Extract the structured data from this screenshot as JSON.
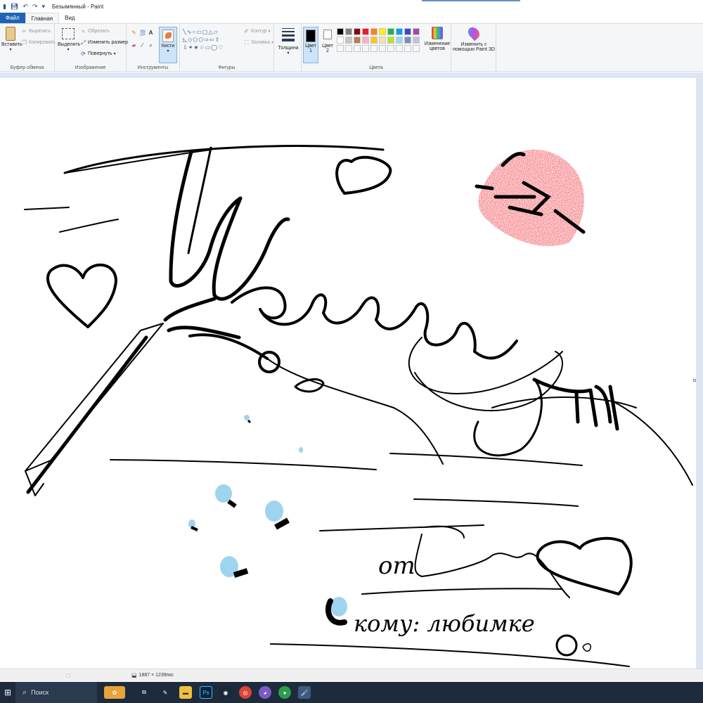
{
  "window": {
    "title": "Безымянный - Paint"
  },
  "tabs": [
    {
      "label": "Файл"
    },
    {
      "label": "Главная"
    },
    {
      "label": "Вид"
    }
  ],
  "ribbon": {
    "clipboard": {
      "paste_label": "Вставить",
      "cut_label": "Вырезать",
      "copy_label": "Копировать",
      "group_label": "Буфер обмена"
    },
    "image": {
      "select_label": "Выделить",
      "crop_label": "Обрезать",
      "resize_label": "Изменить размер",
      "rotate_label": "Повернуть",
      "group_label": "Изображение"
    },
    "tools": {
      "group_label": "Инструменты",
      "brushes_label": "Кисти"
    },
    "shapes": {
      "outline_label": "Контур",
      "fill_label": "Заливка",
      "group_label": "Фигуры"
    },
    "size": {
      "label": "Толщина"
    },
    "colors": {
      "color1_label": "Цвет",
      "color1_index": "1",
      "color2_label": "Цвет",
      "color2_index": "2",
      "edit_label_line1": "Изменение",
      "edit_label_line2": "цветов",
      "group_label": "Цвета",
      "palette_row1": [
        "#000000",
        "#7f7f7f",
        "#880015",
        "#ed1c24",
        "#ff7f27",
        "#fff200",
        "#22b14c",
        "#00a2e8",
        "#3f48cc",
        "#a349a4"
      ],
      "palette_row2": [
        "#ffffff",
        "#c3c3c3",
        "#b97a57",
        "#ffaec9",
        "#ffc90e",
        "#efe4b0",
        "#b5e61d",
        "#99d9ea",
        "#7092be",
        "#c8bfe7"
      ],
      "color1_value": "#000000",
      "color2_value": "#ffffff"
    },
    "paint3d": {
      "label_line1": "Изменить с",
      "label_line2": "помощью Paint 3D"
    }
  },
  "canvas": {
    "text_from": "от",
    "text_to": "кому: любимке"
  },
  "statusbar": {
    "image_size": "1887 × 1239пкс"
  },
  "taskbar": {
    "search_placeholder": "Поиск"
  },
  "accent": {
    "file_tab": "#1f64b4",
    "taskbar": "#1d2b3d",
    "lips": "#e02020",
    "gem": "#9fd4ee"
  }
}
